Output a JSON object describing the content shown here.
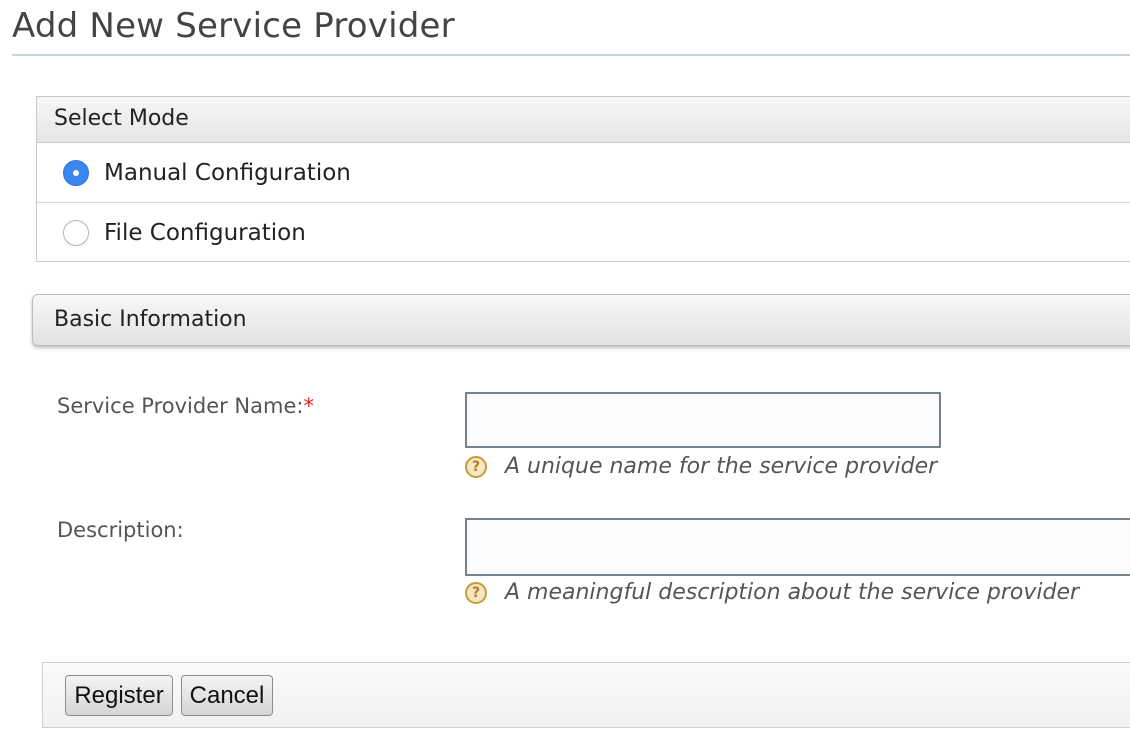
{
  "page": {
    "title": "Add New Service Provider"
  },
  "select_mode": {
    "header": "Select Mode",
    "options": [
      {
        "label": "Manual Configuration",
        "selected": true
      },
      {
        "label": "File Configuration",
        "selected": false
      }
    ]
  },
  "basic_info": {
    "header": "Basic Information",
    "name_field": {
      "label": "Service Provider Name:",
      "required_mark": "*",
      "value": "",
      "help": "A unique name for the service provider"
    },
    "description_field": {
      "label": "Description:",
      "value": "",
      "help": "A meaningful description about the service provider"
    },
    "help_icon": "question-mark-icon"
  },
  "buttons": {
    "register": "Register",
    "cancel": "Cancel"
  },
  "colors": {
    "radio_selected": "#3b86f0",
    "required_mark": "#dd2222",
    "help_icon": "#c9993a"
  }
}
